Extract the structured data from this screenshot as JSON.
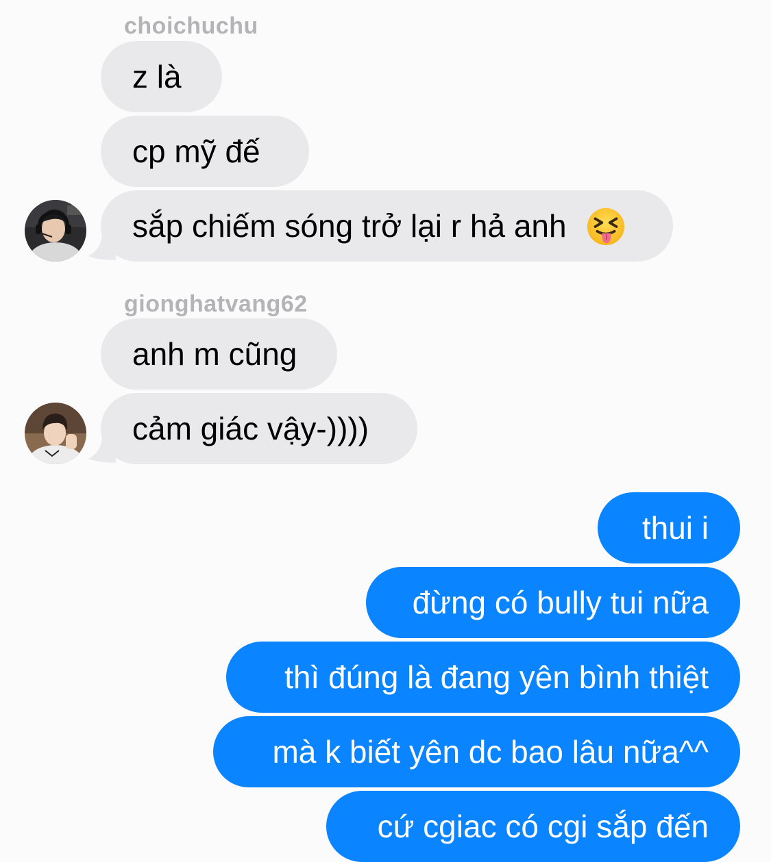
{
  "thread": {
    "groups": [
      {
        "sender": "choichuchu",
        "messages": [
          "z là",
          "cp mỹ đế",
          "sắp chiếm sóng trở lại r hả anh"
        ],
        "avatar_icon": "profile-photo"
      },
      {
        "sender": "gionghatvang62",
        "messages": [
          "anh m cũng",
          "cảm giác vậy-))))"
        ],
        "avatar_icon": "profile-photo"
      }
    ],
    "outgoing": [
      "thui i",
      "đừng có bully tui nữa",
      "thì đúng là đang yên bình thiệt",
      "mà k biết yên dc bao lâu nữa^^",
      "cứ cgiac có cgi sắp đến"
    ],
    "emoji": "face-with-tongue-squinting-icon"
  },
  "colors": {
    "incoming_bubble": "#e9e9eb",
    "outgoing_bubble": "#0a84ff",
    "sender_name": "#b4b4b8",
    "background": "#fbfbfb"
  }
}
